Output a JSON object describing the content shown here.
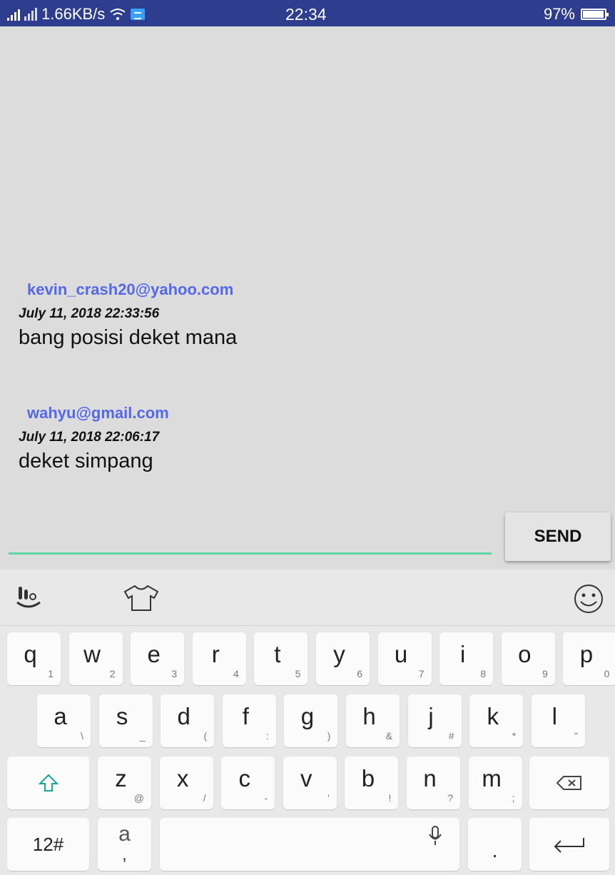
{
  "status_bar": {
    "network_speed": "1.66KB/s",
    "time": "22:34",
    "battery": "97%"
  },
  "messages": [
    {
      "sender": "kevin_crash20@yahoo.com",
      "timestamp": "July 11, 2018 22:33:56",
      "text": "bang posisi deket mana"
    },
    {
      "sender": "wahyu@gmail.com",
      "timestamp": "July 11, 2018 22:06:17",
      "text": "deket simpang"
    }
  ],
  "compose": {
    "input_value": "",
    "send_label": "SEND"
  },
  "keyboard": {
    "row1": [
      {
        "key": "q",
        "sub": "1"
      },
      {
        "key": "w",
        "sub": "2"
      },
      {
        "key": "e",
        "sub": "3"
      },
      {
        "key": "r",
        "sub": "4"
      },
      {
        "key": "t",
        "sub": "5"
      },
      {
        "key": "y",
        "sub": "6"
      },
      {
        "key": "u",
        "sub": "7"
      },
      {
        "key": "i",
        "sub": "8"
      },
      {
        "key": "o",
        "sub": "9"
      },
      {
        "key": "p",
        "sub": "0"
      }
    ],
    "row2": [
      {
        "key": "a",
        "sub": "\\"
      },
      {
        "key": "s",
        "sub": "_"
      },
      {
        "key": "d",
        "sub": "("
      },
      {
        "key": "f",
        "sub": ":"
      },
      {
        "key": "g",
        "sub": ")"
      },
      {
        "key": "h",
        "sub": "&"
      },
      {
        "key": "j",
        "sub": "#"
      },
      {
        "key": "k",
        "sub": "*"
      },
      {
        "key": "l",
        "sub": "\""
      }
    ],
    "row3": [
      {
        "key": "z",
        "sub": "@"
      },
      {
        "key": "x",
        "sub": "/"
      },
      {
        "key": "c",
        "sub": "-"
      },
      {
        "key": "v",
        "sub": "'"
      },
      {
        "key": "b",
        "sub": "!"
      },
      {
        "key": "n",
        "sub": "?"
      },
      {
        "key": "m",
        "sub": ";"
      }
    ],
    "symbols_label": "12#",
    "comma_key": {
      "key": "a",
      "sub": ","
    },
    "period_label": ".",
    "icons": {
      "shift": "shift-icon",
      "backspace": "backspace-icon",
      "enter": "enter-icon",
      "mic": "mic-icon",
      "theme": "shirt-icon",
      "emoji": "emoji-icon",
      "logo": "keyboard-logo-icon"
    }
  },
  "colors": {
    "status_bar": "#2e3d8e",
    "sender": "#5468e8",
    "input_underline": "#5fd4a4",
    "background": "#dcdcdc"
  }
}
